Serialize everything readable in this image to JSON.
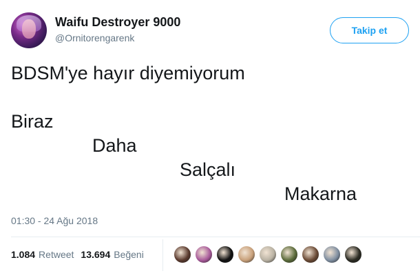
{
  "author": {
    "display_name": "Waifu Destroyer 9000",
    "handle": "@Ornitorengarenk"
  },
  "follow_button": {
    "label": "Takip et"
  },
  "tweet": {
    "lines": [
      "BDSM'ye hayır diyemiyorum",
      "Biraz",
      "Daha",
      "Salçalı",
      "Makarna"
    ]
  },
  "timestamp": "01:30 - 24 Ağu 2018",
  "stats": {
    "retweets_count": "1.084",
    "retweets_label": "Retweet",
    "likes_count": "13.694",
    "likes_label": "Beğeni"
  },
  "colors": {
    "accent": "#1da1f2",
    "text_primary": "#14171a",
    "text_secondary": "#657786",
    "divider": "#e6ecf0"
  },
  "likers": [
    {
      "avatar": "user-avatar-1",
      "color": "#5a3a2e"
    },
    {
      "avatar": "user-avatar-2",
      "color": "#a85a9a"
    },
    {
      "avatar": "user-avatar-3",
      "color": "#111111"
    },
    {
      "avatar": "user-avatar-4",
      "color": "#c8a07a"
    },
    {
      "avatar": "user-avatar-5",
      "color": "#b9b2a3"
    },
    {
      "avatar": "user-avatar-6",
      "color": "#5b6b3a"
    },
    {
      "avatar": "user-avatar-7",
      "color": "#6a4a35"
    },
    {
      "avatar": "user-avatar-8",
      "color": "#7f8ea0"
    },
    {
      "avatar": "user-avatar-9",
      "color": "#2a2a22"
    }
  ]
}
